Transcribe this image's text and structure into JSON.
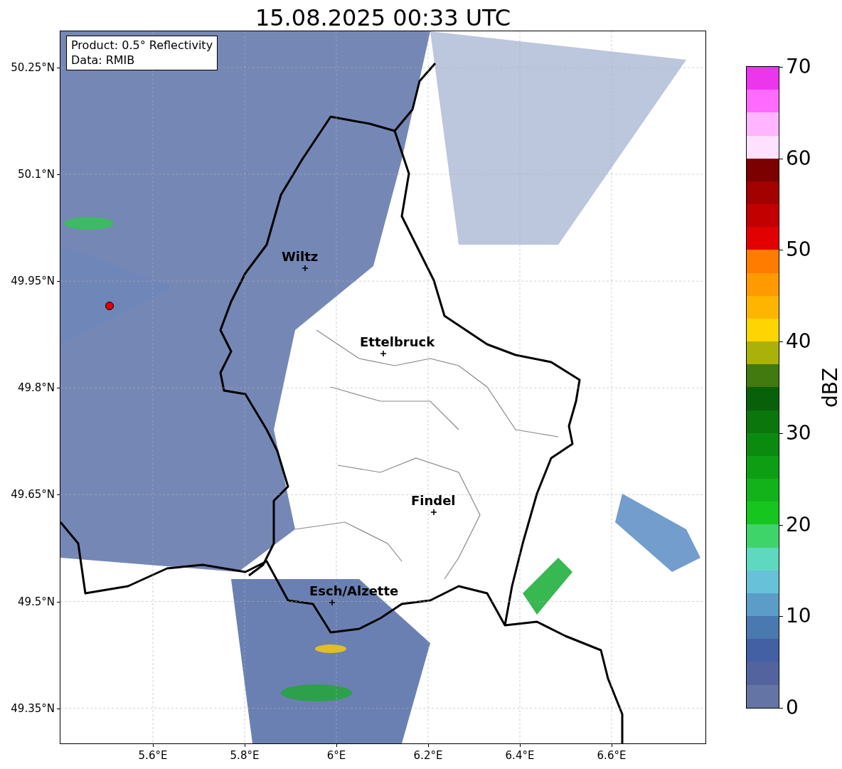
{
  "title": "15.08.2025 00:33 UTC",
  "legend": {
    "lines": [
      "Product: 0.5° Reflectivity",
      "Data: RMIB"
    ]
  },
  "map": {
    "cities": [
      {
        "name": "Wiltz"
      },
      {
        "name": "Ettelbruck"
      },
      {
        "name": "Findel"
      },
      {
        "name": "Esch/Alzette"
      }
    ]
  },
  "y_axis": {
    "ticks": [
      "50.25°N",
      "50.1°N",
      "49.95°N",
      "49.8°N",
      "49.65°N",
      "49.5°N",
      "49.35°N"
    ]
  },
  "x_axis": {
    "ticks": [
      "5.6°E",
      "5.8°E",
      "6°E",
      "6.2°E",
      "6.4°E",
      "6.6°E"
    ]
  },
  "colorbar": {
    "label": "dBZ",
    "ticks": [
      "70",
      "60",
      "50",
      "40",
      "30",
      "20",
      "10",
      "0"
    ],
    "bands": [
      {
        "color": "#ec36ec"
      },
      {
        "color": "#ff6aff"
      },
      {
        "color": "#ffb5ff"
      },
      {
        "color": "#ffe0ff"
      },
      {
        "color": "#7c0000"
      },
      {
        "color": "#a30000"
      },
      {
        "color": "#c30000"
      },
      {
        "color": "#e30000"
      },
      {
        "color": "#ff7c00"
      },
      {
        "color": "#ff9a00"
      },
      {
        "color": "#ffb500"
      },
      {
        "color": "#ffd500"
      },
      {
        "color": "#aab20a"
      },
      {
        "color": "#427a0f"
      },
      {
        "color": "#086109"
      },
      {
        "color": "#0a760c"
      },
      {
        "color": "#0b8a10"
      },
      {
        "color": "#0e9e14"
      },
      {
        "color": "#12b31a"
      },
      {
        "color": "#16c61e"
      },
      {
        "color": "#3fd46a"
      },
      {
        "color": "#5fd8c0"
      },
      {
        "color": "#66c1d9"
      },
      {
        "color": "#5b9dc8"
      },
      {
        "color": "#4a78b0"
      },
      {
        "color": "#4360a5"
      },
      {
        "color": "#52639e"
      },
      {
        "color": "#6474a4"
      }
    ]
  }
}
